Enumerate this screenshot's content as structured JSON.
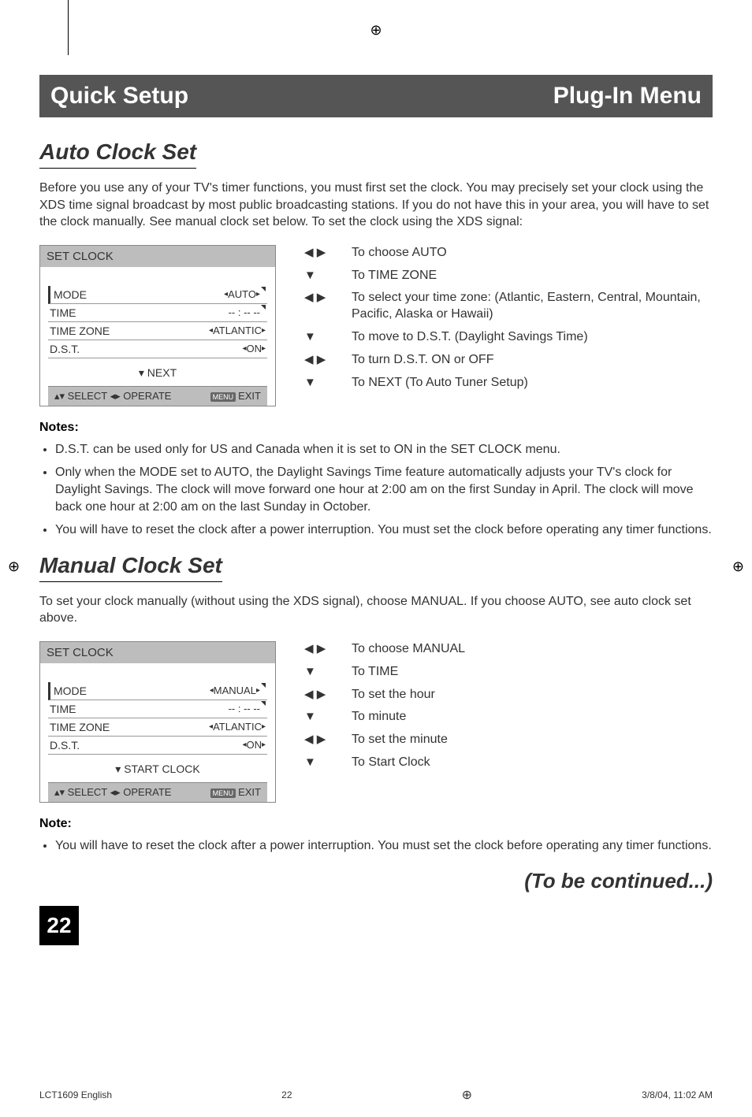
{
  "print_mark": "⊕",
  "header": {
    "left": "Quick Setup",
    "right": "Plug-In Menu"
  },
  "auto": {
    "title": "Auto Clock Set",
    "intro": "Before you use any of your TV's timer functions, you must first set the clock. You may precisely set your clock using the XDS time signal broadcast by most public broadcasting stations. If you do not have this in your area, you will have to set the clock manually. See manual clock set below. To set the clock using the XDS signal:",
    "osd": {
      "title": "SET CLOCK",
      "rows": [
        {
          "label": "MODE",
          "value": "AUTO"
        },
        {
          "label": "TIME",
          "value": "-- : -- --"
        },
        {
          "label": "TIME ZONE",
          "value": "ATLANTIC"
        },
        {
          "label": "D.S.T.",
          "value": "ON"
        }
      ],
      "foot": "▾ NEXT",
      "help_left": "▴▾ SELECT ◂▸ OPERATE",
      "help_menu": "MENU",
      "help_exit": "EXIT"
    },
    "steps": [
      {
        "icon": "◀ ▶",
        "text": "To choose AUTO"
      },
      {
        "icon": "▼",
        "text": "To TIME ZONE"
      },
      {
        "icon": "◀ ▶",
        "text": "To select your time zone: (Atlantic, Eastern, Central, Mountain, Pacific, Alaska or Hawaii)"
      },
      {
        "icon": "▼",
        "text": "To move to D.S.T. (Daylight Savings Time)"
      },
      {
        "icon": "◀ ▶",
        "text": "To turn D.S.T. ON or OFF"
      },
      {
        "icon": "▼",
        "text": "To NEXT (To Auto Tuner Setup)"
      }
    ],
    "notes_h": "Notes:",
    "notes": [
      "D.S.T. can be used only for US and Canada when it is set to ON in the SET CLOCK menu.",
      "Only when the MODE set to AUTO, the Daylight Savings Time feature automatically adjusts your TV's clock for Daylight Savings. The clock will move forward one hour at 2:00 am on the first Sunday in April. The clock will move back one hour at 2:00 am on the last Sunday in October.",
      "You will have to reset the clock after a power interruption. You must set the clock before operating any timer functions."
    ]
  },
  "manual": {
    "title": "Manual Clock Set",
    "intro": "To set your clock manually (without using the XDS signal), choose MANUAL. If you choose AUTO, see auto clock set above.",
    "osd": {
      "title": "SET CLOCK",
      "rows": [
        {
          "label": "MODE",
          "value": "MANUAL"
        },
        {
          "label": "TIME",
          "value": "-- : -- --"
        },
        {
          "label": "TIME ZONE",
          "value": "ATLANTIC"
        },
        {
          "label": "D.S.T.",
          "value": "ON"
        }
      ],
      "foot": "▾ START CLOCK",
      "help_left": "▴▾ SELECT ◂▸ OPERATE",
      "help_menu": "MENU",
      "help_exit": "EXIT"
    },
    "steps": [
      {
        "icon": "◀ ▶",
        "text": "To choose MANUAL"
      },
      {
        "icon": "▼",
        "text": "To TIME"
      },
      {
        "icon": "◀ ▶",
        "text": "To set the hour"
      },
      {
        "icon": "▼",
        "text": "To minute"
      },
      {
        "icon": "◀ ▶",
        "text": "To set the minute"
      },
      {
        "icon": "▼",
        "text": "To Start Clock"
      }
    ],
    "notes_h": "Note:",
    "notes": [
      "You will have to reset the clock after a power interruption. You must set the clock before operating any timer functions."
    ]
  },
  "continued": "(To be continued...)",
  "page_num": "22",
  "footer": {
    "left": "LCT1609 English",
    "center": "22",
    "right": "3/8/04, 11:02 AM"
  }
}
